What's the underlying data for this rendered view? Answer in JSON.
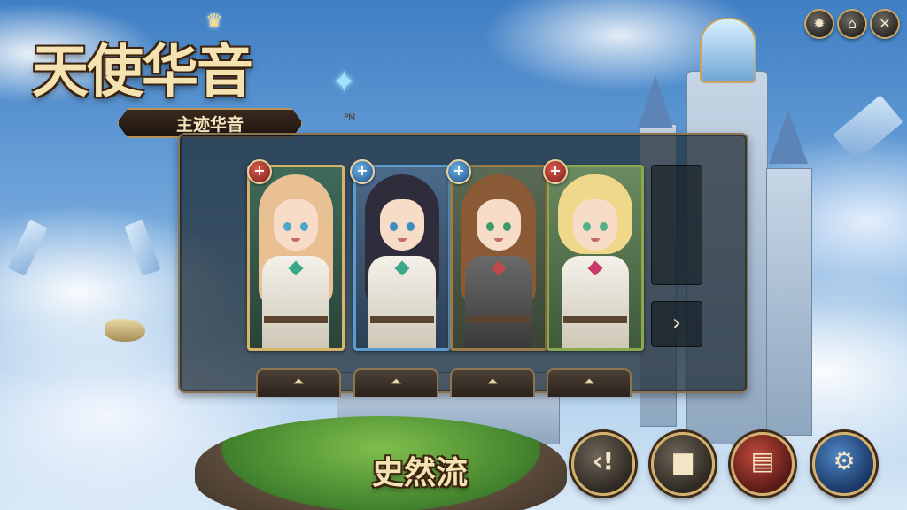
{
  "logo": {
    "title": "天使华音",
    "subtitle": "主迹华音",
    "tm": "PM",
    "star_icon": "sparkle-star-icon",
    "crown_icon": "crown-icon"
  },
  "top_buttons": [
    {
      "name": "settings-gear-button",
      "icon": "gear-icon",
      "glyph": "✹"
    },
    {
      "name": "home-button",
      "icon": "home-icon",
      "glyph": "⌂"
    },
    {
      "name": "close-button",
      "icon": "close-icon",
      "glyph": "✕"
    }
  ],
  "characters": [
    {
      "name": "character-card-1",
      "frame": "gold",
      "badge": "+",
      "badge_color": "red",
      "hair": "#e8c093",
      "eyes": "#4fa6c9",
      "gem": "#3aa88a"
    },
    {
      "name": "character-card-2",
      "frame": "blue",
      "badge": "+",
      "badge_color": "blue",
      "hair": "#2f2c3b",
      "eyes": "#3e8dc0",
      "gem": "#3aa88a"
    },
    {
      "name": "character-card-3",
      "frame": "bronze",
      "badge": "+",
      "badge_color": "blue",
      "hair": "#8a5a36",
      "eyes": "#3d9a6a",
      "gem": "#c04a4a"
    },
    {
      "name": "character-card-4",
      "frame": "green",
      "badge": "+",
      "badge_color": "red",
      "hair": "#f0d88a",
      "eyes": "#4fb08a",
      "gem": "#c83a6a"
    }
  ],
  "next_icon": "chevron-right-icon",
  "next_glyph": "›",
  "bottom": {
    "title": "史然流"
  },
  "bottom_buttons": [
    {
      "name": "back-button",
      "icon": "back-arrow-icon",
      "glyph": "‹!",
      "style": "gray"
    },
    {
      "name": "shop-button",
      "icon": "anvil-icon",
      "glyph": "▆",
      "style": "gray"
    },
    {
      "name": "deck-button",
      "icon": "brush-icon",
      "glyph": "▤",
      "style": "red"
    },
    {
      "name": "options-button",
      "icon": "gear-icon",
      "glyph": "⚙",
      "style": "blue"
    }
  ]
}
